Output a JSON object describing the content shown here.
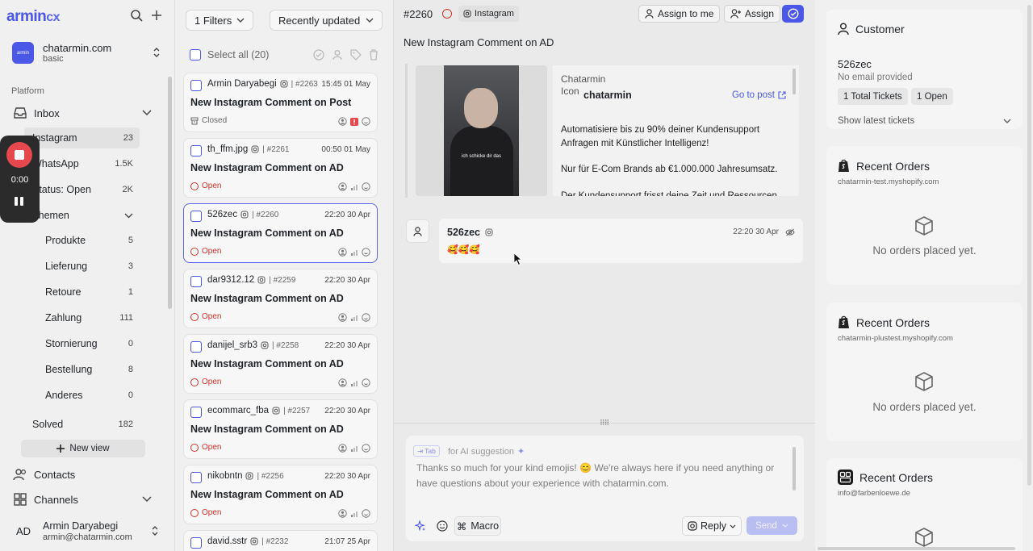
{
  "brand": {
    "logo_main": "armin",
    "logo_suffix": "cx",
    "accent": "#4b57e6",
    "status_open": "#d0342c"
  },
  "workspace": {
    "badge": "armin",
    "name": "chatarmin.com",
    "plan": "basic"
  },
  "sidebar": {
    "section": "Platform",
    "inbox": "Inbox",
    "channels_list": [
      {
        "label": "Instagram",
        "count": "23"
      },
      {
        "label": "WhatsApp",
        "count": "1.5K"
      },
      {
        "label": "Status: Open",
        "count": "2K"
      }
    ],
    "themen": "Themen",
    "topics": [
      {
        "label": "Produkte",
        "count": "5"
      },
      {
        "label": "Lieferung",
        "count": "3"
      },
      {
        "label": "Retoure",
        "count": "1"
      },
      {
        "label": "Zahlung",
        "count": "111"
      },
      {
        "label": "Stornierung",
        "count": "0"
      },
      {
        "label": "Bestellung",
        "count": "8"
      },
      {
        "label": "Anderes",
        "count": "0"
      }
    ],
    "solved": {
      "label": "Solved",
      "count": "182"
    },
    "new_view": "New view",
    "contacts": "Contacts",
    "channels": "Channels",
    "user": {
      "initials": "AD",
      "name": "Armin Daryabegi",
      "email": "armin@chatarmin.com"
    }
  },
  "recorder": {
    "time": "0:00"
  },
  "list": {
    "filters": "1 Filters",
    "sort": "Recently updated",
    "select_all": "Select all (20)",
    "tickets": [
      {
        "author": "Armin Daryabegi",
        "id": "| #2263",
        "time": "15:45 01 May",
        "title": "New Instagram Comment on Post",
        "status": "Closed"
      },
      {
        "author": "th_ffm.jpg",
        "id": "| #2261",
        "time": "00:50 01 May",
        "title": "New Instagram Comment on AD",
        "status": "Open"
      },
      {
        "author": "526zec",
        "id": "| #2260",
        "time": "22:20 30 Apr",
        "title": "New Instagram Comment on AD",
        "status": "Open"
      },
      {
        "author": "dar9312.12",
        "id": "| #2259",
        "time": "22:20 30 Apr",
        "title": "New Instagram Comment on AD",
        "status": "Open"
      },
      {
        "author": "danijel_srb3",
        "id": "| #2258",
        "time": "22:20 30 Apr",
        "title": "New Instagram Comment on AD",
        "status": "Open"
      },
      {
        "author": "ecommarc_fba",
        "id": "| #2257",
        "time": "22:20 30 Apr",
        "title": "New Instagram Comment on AD",
        "status": "Open"
      },
      {
        "author": "nikobntn",
        "id": "| #2256",
        "time": "22:20 30 Apr",
        "title": "New Instagram Comment on AD",
        "status": "Open"
      },
      {
        "author": "david.sstr",
        "id": "| #2232",
        "time": "21:07 25 Apr",
        "title": "",
        "status": ""
      }
    ]
  },
  "conversation": {
    "ticket_number": "#2260",
    "channel": "Instagram",
    "assign_to_me": "Assign to me",
    "assign": "Assign",
    "title": "New Instagram Comment on AD",
    "post": {
      "image_caption": "ich schicke dir das",
      "broken_img_alt": "Chatarmin Icon",
      "account": "chatarmin",
      "go_to_post": "Go to post",
      "text1": "Automatisiere bis zu 90% deiner Kundensupport Anfragen mit Künstlicher Intelligenz!",
      "text2": "Nur für E-Com Brands ab €1.000.000 Jahresumsatz.",
      "text3": "Der Kundensupport frisst deine Zeit und Ressourcen"
    },
    "message": {
      "author": "526zec",
      "time": "22:20 30 Apr",
      "body": "🥰🥰🥰"
    },
    "composer": {
      "tab_chip": "Tab",
      "ai_hint": "for AI suggestion",
      "suggestion": "Thanks so much for your kind emojis! 😊 We're always here if you need anything or have questions about your experience with chatarmin.com.",
      "macro": "Macro",
      "reply": "Reply",
      "send": "Send"
    }
  },
  "customer": {
    "heading": "Customer",
    "name": "526zec",
    "email": "No email provided",
    "total_tickets": "1 Total Tickets",
    "open": "1 Open",
    "latest": "Show latest tickets"
  },
  "orders": [
    {
      "heading": "Recent Orders",
      "shop": "chatarmin-test.myshopify.com",
      "empty": "No orders placed yet."
    },
    {
      "heading": "Recent Orders",
      "shop": "chatarmin-plustest.myshopify.com",
      "empty": "No orders placed yet."
    },
    {
      "heading": "Recent Orders",
      "shop": "info@farbenloewe.de",
      "empty": ""
    }
  ]
}
